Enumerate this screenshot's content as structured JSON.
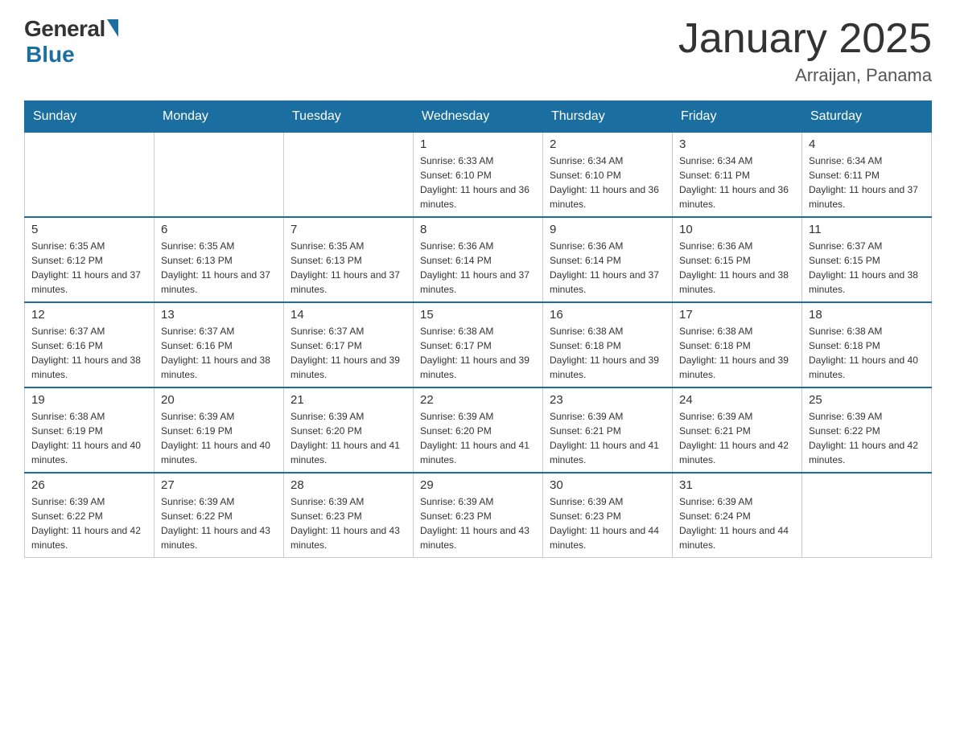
{
  "logo": {
    "general": "General",
    "blue": "Blue"
  },
  "title": "January 2025",
  "location": "Arraijan, Panama",
  "days_header": [
    "Sunday",
    "Monday",
    "Tuesday",
    "Wednesday",
    "Thursday",
    "Friday",
    "Saturday"
  ],
  "weeks": [
    [
      {
        "num": "",
        "info": ""
      },
      {
        "num": "",
        "info": ""
      },
      {
        "num": "",
        "info": ""
      },
      {
        "num": "1",
        "info": "Sunrise: 6:33 AM\nSunset: 6:10 PM\nDaylight: 11 hours and 36 minutes."
      },
      {
        "num": "2",
        "info": "Sunrise: 6:34 AM\nSunset: 6:10 PM\nDaylight: 11 hours and 36 minutes."
      },
      {
        "num": "3",
        "info": "Sunrise: 6:34 AM\nSunset: 6:11 PM\nDaylight: 11 hours and 36 minutes."
      },
      {
        "num": "4",
        "info": "Sunrise: 6:34 AM\nSunset: 6:11 PM\nDaylight: 11 hours and 37 minutes."
      }
    ],
    [
      {
        "num": "5",
        "info": "Sunrise: 6:35 AM\nSunset: 6:12 PM\nDaylight: 11 hours and 37 minutes."
      },
      {
        "num": "6",
        "info": "Sunrise: 6:35 AM\nSunset: 6:13 PM\nDaylight: 11 hours and 37 minutes."
      },
      {
        "num": "7",
        "info": "Sunrise: 6:35 AM\nSunset: 6:13 PM\nDaylight: 11 hours and 37 minutes."
      },
      {
        "num": "8",
        "info": "Sunrise: 6:36 AM\nSunset: 6:14 PM\nDaylight: 11 hours and 37 minutes."
      },
      {
        "num": "9",
        "info": "Sunrise: 6:36 AM\nSunset: 6:14 PM\nDaylight: 11 hours and 37 minutes."
      },
      {
        "num": "10",
        "info": "Sunrise: 6:36 AM\nSunset: 6:15 PM\nDaylight: 11 hours and 38 minutes."
      },
      {
        "num": "11",
        "info": "Sunrise: 6:37 AM\nSunset: 6:15 PM\nDaylight: 11 hours and 38 minutes."
      }
    ],
    [
      {
        "num": "12",
        "info": "Sunrise: 6:37 AM\nSunset: 6:16 PM\nDaylight: 11 hours and 38 minutes."
      },
      {
        "num": "13",
        "info": "Sunrise: 6:37 AM\nSunset: 6:16 PM\nDaylight: 11 hours and 38 minutes."
      },
      {
        "num": "14",
        "info": "Sunrise: 6:37 AM\nSunset: 6:17 PM\nDaylight: 11 hours and 39 minutes."
      },
      {
        "num": "15",
        "info": "Sunrise: 6:38 AM\nSunset: 6:17 PM\nDaylight: 11 hours and 39 minutes."
      },
      {
        "num": "16",
        "info": "Sunrise: 6:38 AM\nSunset: 6:18 PM\nDaylight: 11 hours and 39 minutes."
      },
      {
        "num": "17",
        "info": "Sunrise: 6:38 AM\nSunset: 6:18 PM\nDaylight: 11 hours and 39 minutes."
      },
      {
        "num": "18",
        "info": "Sunrise: 6:38 AM\nSunset: 6:18 PM\nDaylight: 11 hours and 40 minutes."
      }
    ],
    [
      {
        "num": "19",
        "info": "Sunrise: 6:38 AM\nSunset: 6:19 PM\nDaylight: 11 hours and 40 minutes."
      },
      {
        "num": "20",
        "info": "Sunrise: 6:39 AM\nSunset: 6:19 PM\nDaylight: 11 hours and 40 minutes."
      },
      {
        "num": "21",
        "info": "Sunrise: 6:39 AM\nSunset: 6:20 PM\nDaylight: 11 hours and 41 minutes."
      },
      {
        "num": "22",
        "info": "Sunrise: 6:39 AM\nSunset: 6:20 PM\nDaylight: 11 hours and 41 minutes."
      },
      {
        "num": "23",
        "info": "Sunrise: 6:39 AM\nSunset: 6:21 PM\nDaylight: 11 hours and 41 minutes."
      },
      {
        "num": "24",
        "info": "Sunrise: 6:39 AM\nSunset: 6:21 PM\nDaylight: 11 hours and 42 minutes."
      },
      {
        "num": "25",
        "info": "Sunrise: 6:39 AM\nSunset: 6:22 PM\nDaylight: 11 hours and 42 minutes."
      }
    ],
    [
      {
        "num": "26",
        "info": "Sunrise: 6:39 AM\nSunset: 6:22 PM\nDaylight: 11 hours and 42 minutes."
      },
      {
        "num": "27",
        "info": "Sunrise: 6:39 AM\nSunset: 6:22 PM\nDaylight: 11 hours and 43 minutes."
      },
      {
        "num": "28",
        "info": "Sunrise: 6:39 AM\nSunset: 6:23 PM\nDaylight: 11 hours and 43 minutes."
      },
      {
        "num": "29",
        "info": "Sunrise: 6:39 AM\nSunset: 6:23 PM\nDaylight: 11 hours and 43 minutes."
      },
      {
        "num": "30",
        "info": "Sunrise: 6:39 AM\nSunset: 6:23 PM\nDaylight: 11 hours and 44 minutes."
      },
      {
        "num": "31",
        "info": "Sunrise: 6:39 AM\nSunset: 6:24 PM\nDaylight: 11 hours and 44 minutes."
      },
      {
        "num": "",
        "info": ""
      }
    ]
  ]
}
